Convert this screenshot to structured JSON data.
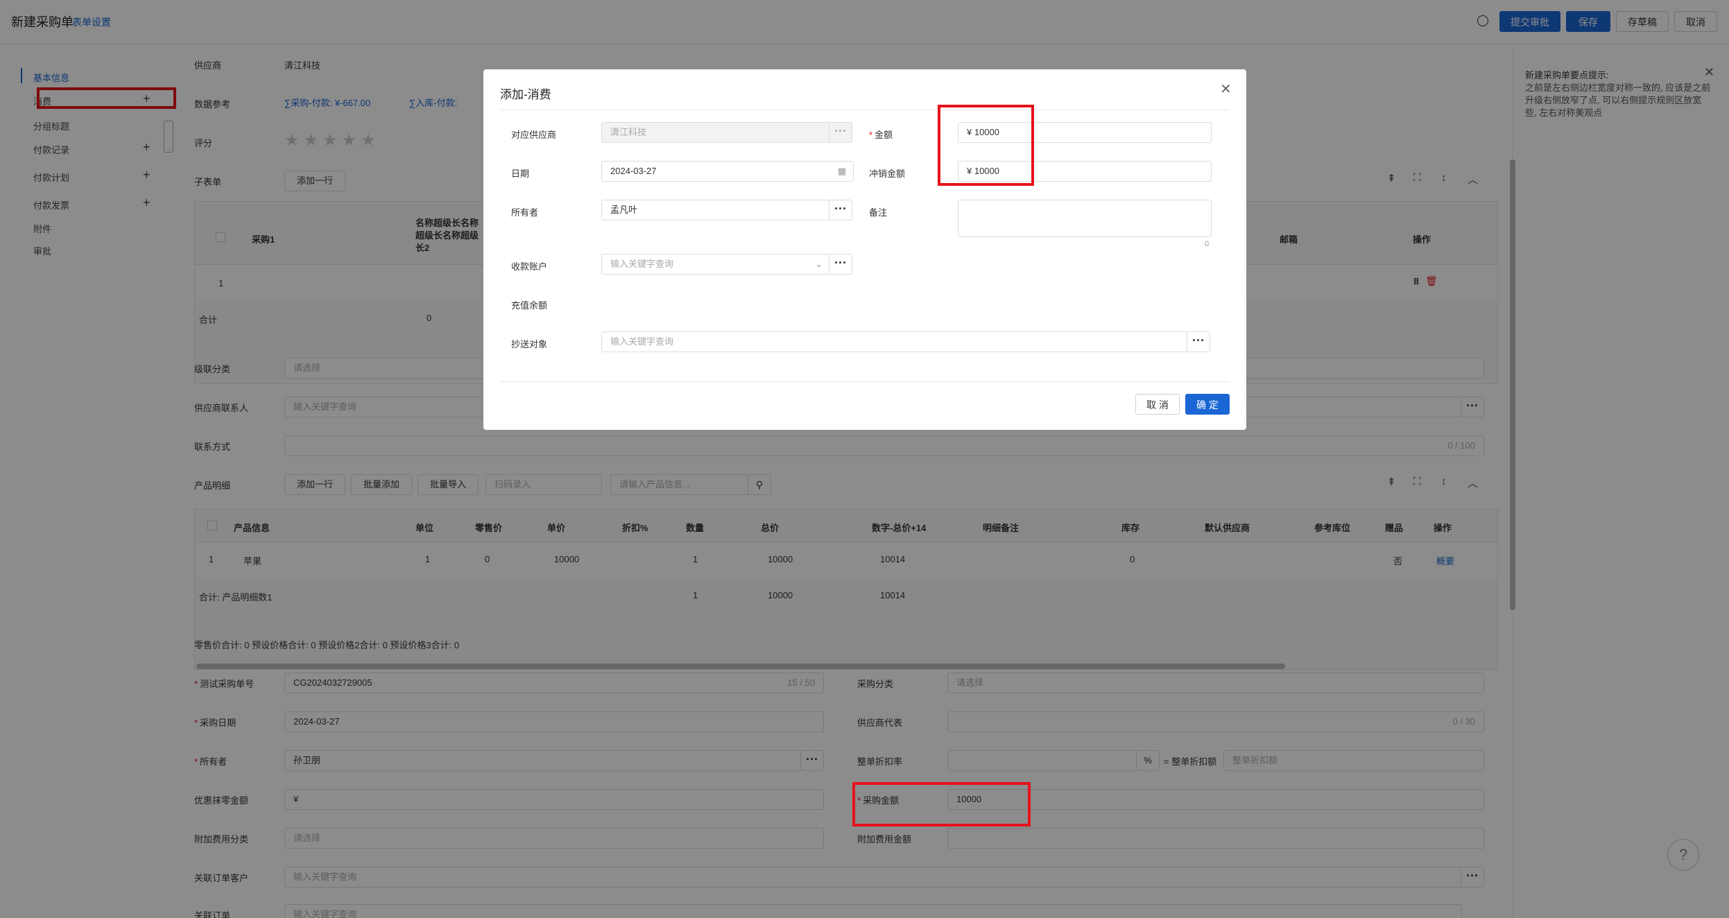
{
  "header": {
    "title": "新建采购单",
    "form_settings": "表单设置",
    "submit_label": "提交审批",
    "save_label": "保存",
    "draft_label": "存草稿",
    "cancel_label": "取消"
  },
  "sidebar": {
    "items": [
      {
        "label": "基本信息",
        "plus": false
      },
      {
        "label": "消费",
        "plus": true
      },
      {
        "label": "分组标题",
        "plus": false
      },
      {
        "label": "付款记录",
        "plus": true
      },
      {
        "label": "付款计划",
        "plus": true
      },
      {
        "label": "付款发票",
        "plus": true
      },
      {
        "label": "附件",
        "plus": false
      },
      {
        "label": "审批",
        "plus": false
      }
    ]
  },
  "form": {
    "supplier_label": "供应商",
    "supplier_value": "清江科技",
    "data_ref_label": "数据参考",
    "data_ref_1": "∑采购-付款: ¥-667.00",
    "data_ref_2": "∑入库-付款:",
    "rating_label": "评分",
    "subtable_label": "子表单",
    "add_row": "添加一行",
    "cascade_label": "级联分类",
    "cascade_ph": "请选择",
    "contact_label": "供应商联系人",
    "contact_ph": "输入关键字查询",
    "phone_label": "联系方式",
    "phone_count": "0 / 100",
    "product_label": "产品明细",
    "batch_add": "批量添加",
    "batch_import": "批量导入",
    "scan_ph": "扫码录入",
    "product_search_ph": "请输入产品信息...",
    "totals_line": "零售价合计: 0  预设价格合计: 0  预设价格2合计: 0  预设价格3合计: 0",
    "order_no_label": "测试采购单号",
    "order_no_value": "CG2024032729005",
    "order_no_count": "15 / 50",
    "purchase_cat_label": "采购分类",
    "purchase_cat_ph": "请选择",
    "date_label": "采购日期",
    "date_value": "2024-03-27",
    "supplier_rep_label": "供应商代表",
    "supplier_rep_count": "0 / 30",
    "owner_label": "所有者",
    "owner_value": "孙卫朋",
    "discount_rate_label": "整单折扣率",
    "percent": "%",
    "discount_amount_label": "= 整单折扣额",
    "discount_amount_ph": "整单折扣额",
    "round_label": "优惠抹零金额",
    "round_value": "¥",
    "amount_label": "采购金额",
    "amount_value": "10000",
    "fee_cat_label": "附加费用分类",
    "fee_cat_ph": "请选择",
    "fee_amount_label": "附加费用金额",
    "linked_customer_label": "关联订单客户",
    "linked_customer_ph": "输入关键字查询",
    "linked_order_label": "关联订单",
    "linked_order_ph": "输入关键字查询"
  },
  "subtable": {
    "headers": [
      "采购1",
      "名称超级长名称超级长名称超级长2",
      "邮箱",
      "操作"
    ],
    "row_index": "1",
    "total_label": "合计",
    "total_value": "0"
  },
  "product_table": {
    "headers": [
      "产品信息",
      "单位",
      "零售价",
      "单价",
      "折扣%",
      "数量",
      "总价",
      "数字-总价+14",
      "明细备注",
      "库存",
      "默认供应商",
      "参考库位",
      "赠品",
      "操作"
    ],
    "row": [
      "1",
      "苹果",
      "1",
      "0",
      "10000",
      "",
      "1",
      "10000",
      "10014",
      "",
      "0",
      "",
      "",
      "否",
      "概要"
    ],
    "total_label": "合计: 产品明细数1",
    "total_qty": "1",
    "total_price": "10000",
    "total_num": "10014"
  },
  "right_panel": {
    "title": "新建采购单要点提示:",
    "text": "之前是左右侧边栏宽度对称一致的, 应该是之前升级右侧放窄了点, 可以右侧提示规则区放宽些, 左右对称美观点"
  },
  "modal": {
    "title": "添加-消费",
    "supplier_label": "对应供应商",
    "supplier_value": "清江科技",
    "amount_label": "金额",
    "amount_value": "¥  10000",
    "date_label": "日期",
    "date_value": "2024-03-27",
    "offset_label": "冲销金额",
    "offset_value": "¥  10000",
    "owner_label": "所有者",
    "owner_value": "孟凡叶",
    "remark_label": "备注",
    "remark_count": "0",
    "account_label": "收款账户",
    "account_ph": "输入关键字查询",
    "balance_label": "充值余额",
    "cc_label": "抄送对象",
    "cc_ph": "输入关键字查询",
    "cancel_label": "取 消",
    "ok_label": "确 定"
  },
  "colors": {
    "primary": "#1a66d4",
    "highlight": "#e5121b",
    "required": "#e5121b"
  }
}
